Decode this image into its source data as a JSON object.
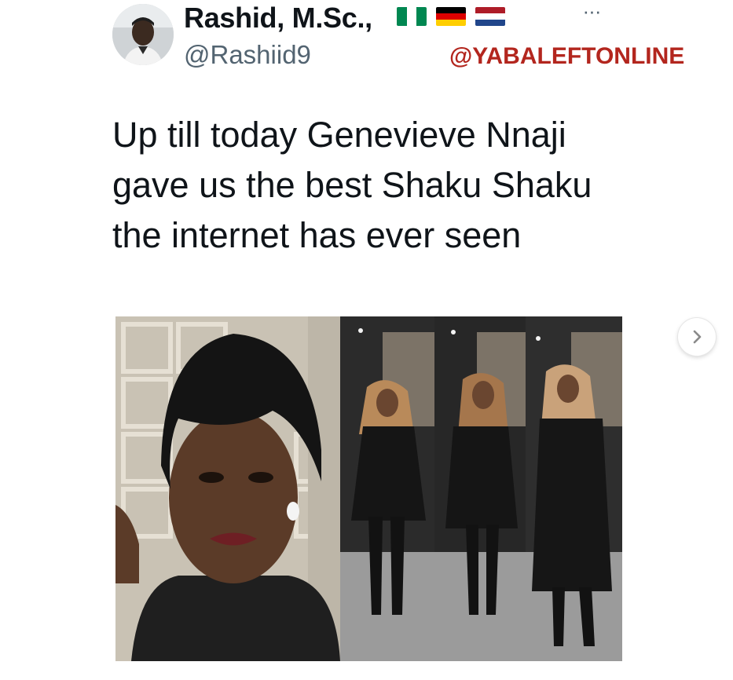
{
  "tweet": {
    "author_name": "Rashid, M.Sc.,",
    "handle": "@Rashiid9",
    "more_label": "···",
    "watermark": "@YABALEFTONLINE",
    "text": "Up till today Genevieve Nnaji gave us the best Shaku Shaku the internet has ever seen"
  },
  "flags": [
    {
      "name": "nigeria-flag-icon",
      "colors": [
        "#008751",
        "#ffffff",
        "#008751"
      ]
    },
    {
      "name": "germany-flag-icon",
      "colors": [
        "#000000",
        "#dd0000",
        "#ffce00"
      ]
    },
    {
      "name": "netherlands-flag-icon",
      "colors": [
        "#ae1c28",
        "#ffffff",
        "#21468b"
      ]
    }
  ],
  "colors": {
    "text_primary": "#0f1419",
    "text_secondary": "#536471",
    "watermark": "#b3261e"
  },
  "icons": {
    "more": "more-options-icon",
    "next": "chevron-right-icon"
  }
}
